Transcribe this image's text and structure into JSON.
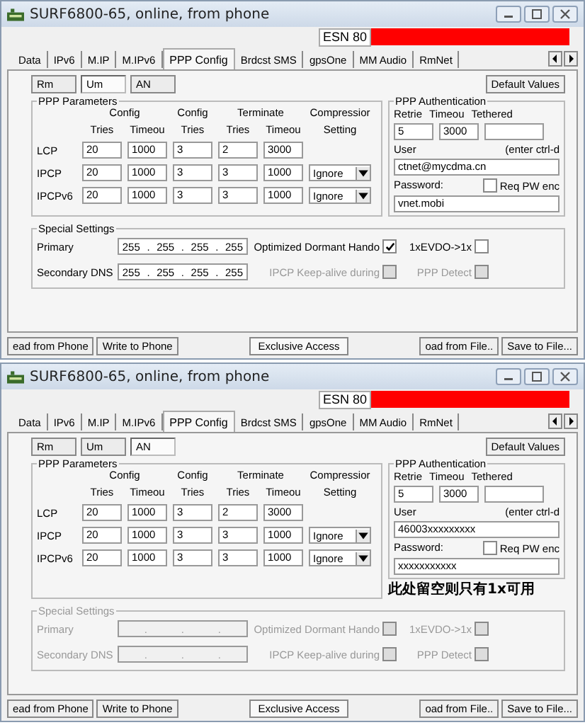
{
  "windows": [
    {
      "title": "SURF6800-65, online, from phone",
      "esn": "ESN 80",
      "tabs": [
        {
          "label": "Data",
          "selected": false
        },
        {
          "label": "IPv6",
          "selected": false
        },
        {
          "label": "M.IP",
          "selected": false
        },
        {
          "label": "M.IPv6",
          "selected": false
        },
        {
          "label": "PPP Config",
          "selected": true
        },
        {
          "label": "Brdcst SMS",
          "selected": false
        },
        {
          "label": "gpsOne",
          "selected": false
        },
        {
          "label": "MM Audio",
          "selected": false
        },
        {
          "label": "RmNet",
          "selected": false
        }
      ],
      "subtabs": [
        {
          "label": "Rm",
          "selected": false
        },
        {
          "label": "Um",
          "selected": true
        },
        {
          "label": "AN",
          "selected": false
        }
      ],
      "default_button": "Default Values",
      "params": {
        "title": "PPP Parameters",
        "header_top": [
          "Config",
          "Config",
          "Terminate",
          "Compressior"
        ],
        "header_bottom": [
          "Tries",
          "Timeou",
          "Tries",
          "Tries",
          "Timeou",
          "Setting"
        ],
        "rows": [
          {
            "label": "LCP",
            "values": [
              "20",
              "1000",
              "3",
              "2",
              "3000"
            ]
          },
          {
            "label": "IPCP",
            "values": [
              "20",
              "1000",
              "3",
              "3",
              "1000"
            ],
            "compression": "Ignore"
          },
          {
            "label": "IPCPv6",
            "values": [
              "20",
              "1000",
              "3",
              "3",
              "1000"
            ],
            "compression": "Ignore"
          }
        ]
      },
      "auth": {
        "title": "PPP Authentication",
        "headers": [
          "Retrie",
          "Timeou",
          "Tethered"
        ],
        "retries": "5",
        "timeout": "3000",
        "user_label": "User",
        "user_hint": "(enter ctrl-d",
        "user": "ctnet@mycdma.cn",
        "password_label": "Password:",
        "req_pw": {
          "label": "Req PW enc",
          "checked": false
        },
        "password": "vnet.mobi"
      },
      "special": {
        "title": "Special Settings",
        "disabled": false,
        "separator": ".",
        "rows": [
          {
            "label": "Primary",
            "ip": [
              "255",
              "255",
              "255",
              "255"
            ],
            "options": [
              {
                "label": "Optimized Dormant Hando",
                "checked": true,
                "disabled": false
              },
              {
                "label": "1xEVDO->1x",
                "checked": false,
                "disabled": false
              }
            ]
          },
          {
            "label": "Secondary DNS",
            "ip": [
              "255",
              "255",
              "255",
              "255"
            ],
            "options": [
              {
                "label": "IPCP Keep-alive during",
                "checked": false,
                "disabled": true
              },
              {
                "label": "PPP Detect",
                "checked": false,
                "disabled": true
              }
            ]
          }
        ]
      },
      "buttons": [
        "ead from Phone",
        "Write to Phone",
        "Exclusive Access",
        "oad from File..",
        "Save to File..."
      ]
    },
    {
      "title": "SURF6800-65, online, from phone",
      "esn": "ESN 80",
      "tabs": [
        {
          "label": "Data",
          "selected": false
        },
        {
          "label": "IPv6",
          "selected": false
        },
        {
          "label": "M.IP",
          "selected": false
        },
        {
          "label": "M.IPv6",
          "selected": false
        },
        {
          "label": "PPP Config",
          "selected": true
        },
        {
          "label": "Brdcst SMS",
          "selected": false
        },
        {
          "label": "gpsOne",
          "selected": false
        },
        {
          "label": "MM Audio",
          "selected": false
        },
        {
          "label": "RmNet",
          "selected": false
        }
      ],
      "subtabs": [
        {
          "label": "Rm",
          "selected": false
        },
        {
          "label": "Um",
          "selected": false
        },
        {
          "label": "AN",
          "selected": true
        }
      ],
      "default_button": "Default Values",
      "params": {
        "title": "PPP Parameters",
        "header_top": [
          "Config",
          "Config",
          "Terminate",
          "Compressior"
        ],
        "header_bottom": [
          "Tries",
          "Timeou",
          "Tries",
          "Tries",
          "Timeou",
          "Setting"
        ],
        "rows": [
          {
            "label": "LCP",
            "values": [
              "20",
              "1000",
              "3",
              "2",
              "3000"
            ]
          },
          {
            "label": "IPCP",
            "values": [
              "20",
              "1000",
              "3",
              "3",
              "1000"
            ],
            "compression": "Ignore"
          },
          {
            "label": "IPCPv6",
            "values": [
              "20",
              "1000",
              "3",
              "3",
              "1000"
            ],
            "compression": "Ignore"
          }
        ]
      },
      "auth": {
        "title": "PPP Authentication",
        "headers": [
          "Retrie",
          "Timeou",
          "Tethered"
        ],
        "retries": "5",
        "timeout": "3000",
        "user_label": "User",
        "user_hint": "(enter ctrl-d",
        "user": "46003xxxxxxxxx",
        "password_label": "Password:",
        "req_pw": {
          "label": "Req PW enc",
          "checked": false
        },
        "password": "xxxxxxxxxxx"
      },
      "note": "此处留空则只有1x可用",
      "special": {
        "title": "Special Settings",
        "disabled": true,
        "separator": ".",
        "rows": [
          {
            "label": "Primary",
            "options": [
              {
                "label": "Optimized Dormant Hando",
                "checked": false
              },
              {
                "label": "1xEVDO->1x",
                "checked": false
              }
            ]
          },
          {
            "label": "Secondary DNS",
            "options": [
              {
                "label": "IPCP Keep-alive during",
                "checked": false
              },
              {
                "label": "PPP Detect",
                "checked": false
              }
            ]
          }
        ]
      },
      "buttons": [
        "ead from Phone",
        "Write to Phone",
        "Exclusive Access",
        "oad from File..",
        "Save to File..."
      ]
    }
  ]
}
